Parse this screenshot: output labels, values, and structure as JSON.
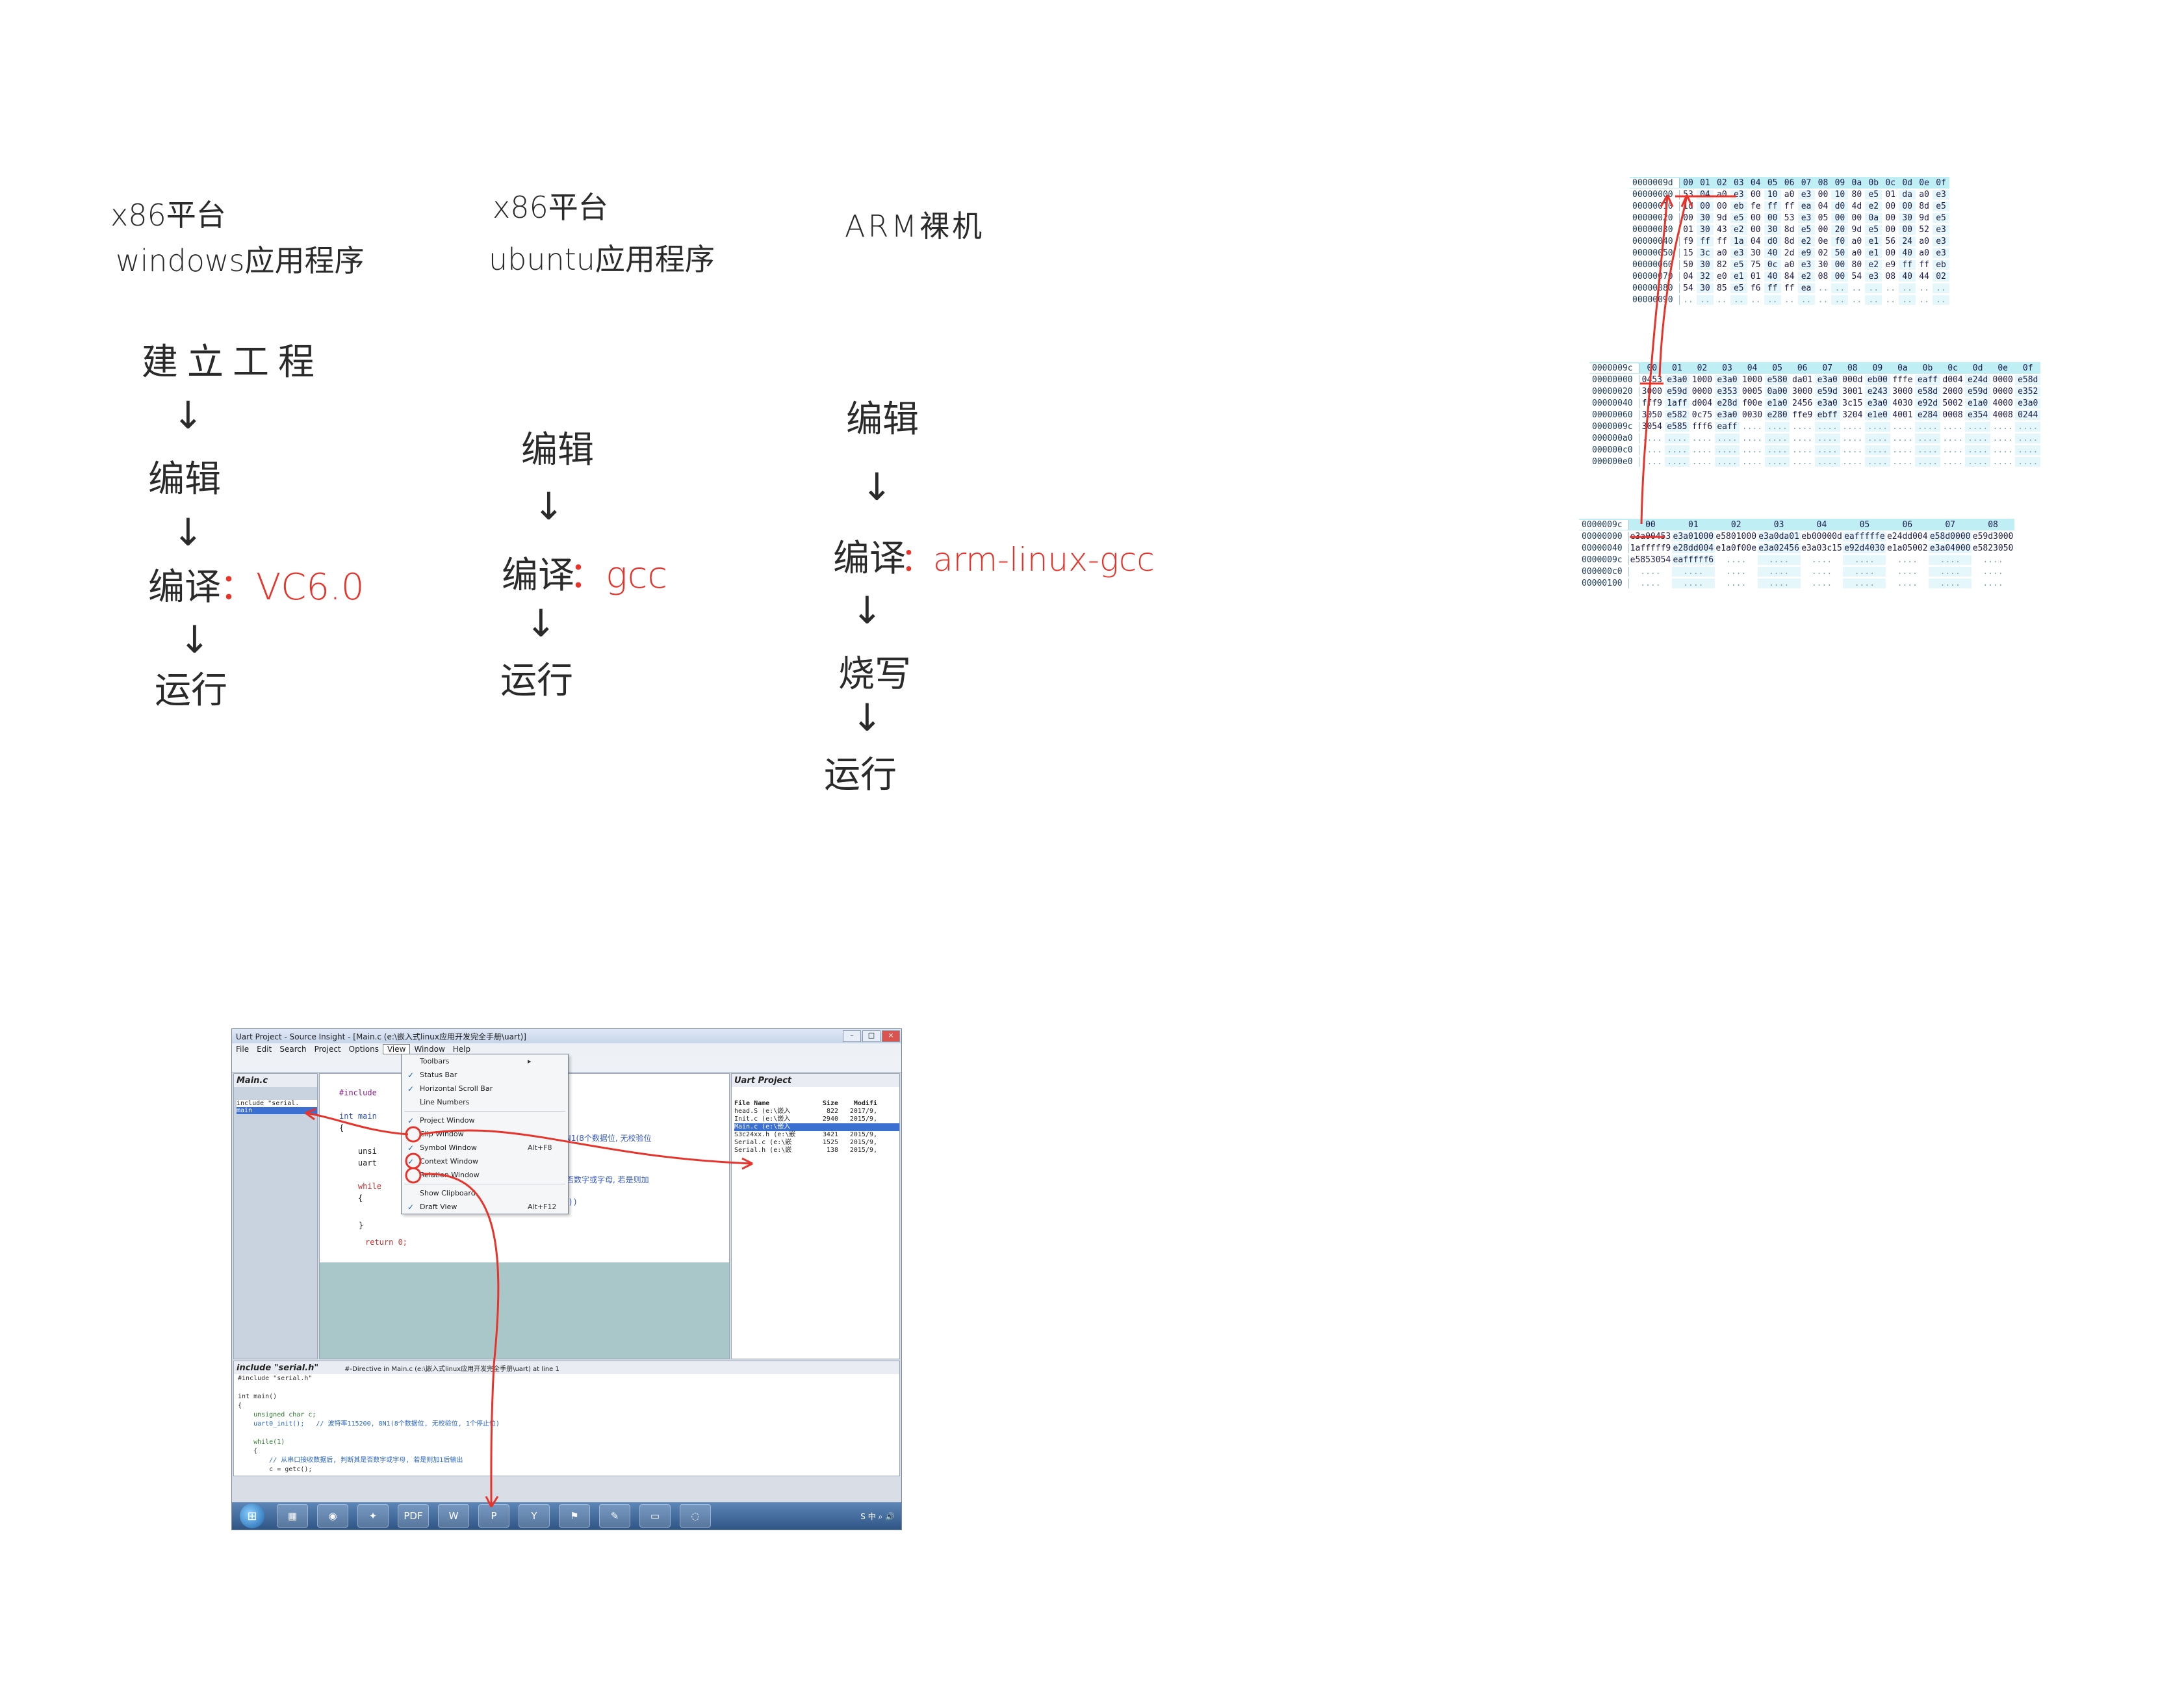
{
  "col1": {
    "platform": "x86平台",
    "app_type": "windows应用程序",
    "steps": [
      "建立工程",
      "编辑",
      "编译",
      "运行"
    ],
    "compiler": "：VC6.0"
  },
  "col2": {
    "platform": "x86平台",
    "app_type": "ubuntu应用程序",
    "steps": [
      "编辑",
      "编译",
      "运行"
    ],
    "compiler": "：gcc"
  },
  "col3": {
    "platform": "ARM裸机",
    "steps": [
      "编辑",
      "编译",
      "烧写",
      "运行"
    ],
    "compiler": "：arm-linux-gcc"
  },
  "arrow_glyph": "↓",
  "hex1": {
    "corner": "0000009d",
    "header": [
      "00",
      "01",
      "02",
      "03",
      "04",
      "05",
      "06",
      "07",
      "08",
      "09",
      "0a",
      "0b",
      "0c",
      "0d",
      "0e",
      "0f"
    ],
    "rows": [
      {
        "addr": "00000000",
        "bytes": [
          "53",
          "04",
          "a0",
          "e3",
          "00",
          "10",
          "a0",
          "e3",
          "00",
          "10",
          "80",
          "e5",
          "01",
          "da",
          "a0",
          "e3"
        ]
      },
      {
        "addr": "00000010",
        "bytes": [
          "1d",
          "00",
          "00",
          "eb",
          "fe",
          "ff",
          "ff",
          "ea",
          "04",
          "d0",
          "4d",
          "e2",
          "00",
          "00",
          "8d",
          "e5"
        ]
      },
      {
        "addr": "00000020",
        "bytes": [
          "00",
          "30",
          "9d",
          "e5",
          "00",
          "00",
          "53",
          "e3",
          "05",
          "00",
          "00",
          "0a",
          "00",
          "30",
          "9d",
          "e5"
        ]
      },
      {
        "addr": "00000030",
        "bytes": [
          "01",
          "30",
          "43",
          "e2",
          "00",
          "30",
          "8d",
          "e5",
          "00",
          "20",
          "9d",
          "e5",
          "00",
          "00",
          "52",
          "e3"
        ]
      },
      {
        "addr": "00000040",
        "bytes": [
          "f9",
          "ff",
          "ff",
          "1a",
          "04",
          "d0",
          "8d",
          "e2",
          "0e",
          "f0",
          "a0",
          "e1",
          "56",
          "24",
          "a0",
          "e3"
        ]
      },
      {
        "addr": "00000050",
        "bytes": [
          "15",
          "3c",
          "a0",
          "e3",
          "30",
          "40",
          "2d",
          "e9",
          "02",
          "50",
          "a0",
          "e1",
          "00",
          "40",
          "a0",
          "e3"
        ]
      },
      {
        "addr": "00000060",
        "bytes": [
          "50",
          "30",
          "82",
          "e5",
          "75",
          "0c",
          "a0",
          "e3",
          "30",
          "00",
          "80",
          "e2",
          "e9",
          "ff",
          "ff",
          "eb"
        ]
      },
      {
        "addr": "00000070",
        "bytes": [
          "04",
          "32",
          "e0",
          "e1",
          "01",
          "40",
          "84",
          "e2",
          "08",
          "00",
          "54",
          "e3",
          "08",
          "40",
          "44",
          "02"
        ]
      },
      {
        "addr": "00000080",
        "bytes": [
          "54",
          "30",
          "85",
          "e5",
          "f6",
          "ff",
          "ff",
          "ea",
          "",
          "",
          "",
          "",
          "",
          "",
          "",
          ""
        ]
      },
      {
        "addr": "00000090",
        "bytes": [
          "",
          "",
          "",
          "",
          "",
          "",
          "",
          "",
          "",
          "",
          "",
          "",
          "",
          "",
          "",
          ""
        ]
      }
    ]
  },
  "hex2": {
    "corner": "0000009c",
    "header": [
      "00",
      "01",
      "02",
      "03",
      "04",
      "05",
      "06",
      "07",
      "08",
      "09",
      "0a",
      "0b",
      "0c",
      "0d",
      "0e",
      "0f"
    ],
    "rows": [
      {
        "addr": "00000000",
        "words": [
          "0453",
          "e3a0",
          "1000",
          "e3a0",
          "1000",
          "e580",
          "da01",
          "e3a0",
          "000d",
          "eb00",
          "fffe",
          "eaff",
          "d004",
          "e24d",
          "0000",
          "e58d"
        ]
      },
      {
        "addr": "00000020",
        "words": [
          "3000",
          "e59d",
          "0000",
          "e353",
          "0005",
          "0a00",
          "3000",
          "e59d",
          "3001",
          "e243",
          "3000",
          "e58d",
          "2000",
          "e59d",
          "0000",
          "e352"
        ]
      },
      {
        "addr": "00000040",
        "words": [
          "fff9",
          "1aff",
          "d004",
          "e28d",
          "f00e",
          "e1a0",
          "2456",
          "e3a0",
          "3c15",
          "e3a0",
          "4030",
          "e92d",
          "5002",
          "e1a0",
          "4000",
          "e3a0"
        ]
      },
      {
        "addr": "00000060",
        "words": [
          "3050",
          "e582",
          "0c75",
          "e3a0",
          "0030",
          "e280",
          "ffe9",
          "ebff",
          "3204",
          "e1e0",
          "4001",
          "e284",
          "0008",
          "e354",
          "4008",
          "0244"
        ]
      },
      {
        "addr": "0000009c",
        "words": [
          "3054",
          "e585",
          "fff6",
          "eaff",
          "",
          "",
          "",
          "",
          "",
          "",
          "",
          "",
          "",
          "",
          "",
          ""
        ]
      },
      {
        "addr": "000000a0",
        "words": [
          "",
          "",
          "",
          "",
          "",
          "",
          "",
          "",
          "",
          "",
          "",
          "",
          "",
          "",
          "",
          ""
        ]
      },
      {
        "addr": "000000c0",
        "words": [
          "",
          "",
          "",
          "",
          "",
          "",
          "",
          "",
          "",
          "",
          "",
          "",
          "",
          "",
          "",
          ""
        ]
      },
      {
        "addr": "000000e0",
        "words": [
          "",
          "",
          "",
          "",
          "",
          "",
          "",
          "",
          "",
          "",
          "",
          "",
          "",
          "",
          "",
          ""
        ]
      }
    ]
  },
  "hex3": {
    "corner": "0000009c",
    "header": [
      "00",
      "01",
      "02",
      "03",
      "04",
      "05",
      "06",
      "07",
      "08"
    ],
    "rows": [
      {
        "addr": "00000000",
        "dwords": [
          "e3a00453",
          "e3a01000",
          "e5801000",
          "e3a0da01",
          "eb00000d",
          "eafffffe",
          "e24dd004",
          "e58d0000",
          "e59d3000"
        ]
      },
      {
        "addr": "00000040",
        "dwords": [
          "1afffff9",
          "e28dd004",
          "e1a0f00e",
          "e3a02456",
          "e3a03c15",
          "e92d4030",
          "e1a05002",
          "e3a04000",
          "e5823050"
        ]
      },
      {
        "addr": "0000009c",
        "dwords": [
          "e5853054",
          "eafffff6",
          "",
          "",
          "",
          "",
          "",
          "",
          ""
        ]
      },
      {
        "addr": "000000c0",
        "dwords": [
          "",
          "",
          "",
          "",
          "",
          "",
          "",
          "",
          ""
        ]
      },
      {
        "addr": "00000100",
        "dwords": [
          "",
          "",
          "",
          "",
          "",
          "",
          "",
          "",
          ""
        ]
      }
    ]
  },
  "screenshot": {
    "title": "Uart Project - Source Insight - [Main.c (e:\\嵌入式linux应用开发完全手册\\uart)]",
    "window_controls": [
      "–",
      "□",
      "×"
    ],
    "menu": [
      "File",
      "Edit",
      "Search",
      "Project",
      "Options",
      "View",
      "Window",
      "Help"
    ],
    "symbol_pane": {
      "title": "Main.c",
      "items": [
        "include \"serial.",
        "main"
      ]
    },
    "editor_lines": [
      "#include",
      "",
      "int main",
      "{",
      "    unsi",
      "    uart",
      "",
      "    while",
      "    {",
      "",
      "",
      "",
      ""
    ],
    "editor_fragments": {
      "a": "0, 8N1(8个数据位, 无校验位",
      "b": "其是否数字或字母, 若是则加",
      "c": "(c))",
      "ret": "return 0;",
      "brace_close": "}"
    },
    "view_menu": [
      {
        "label": "Toolbars",
        "check": "",
        "shortcut": "",
        "submenu": "▸"
      },
      {
        "label": "Status Bar",
        "check": "✓",
        "shortcut": "",
        "submenu": ""
      },
      {
        "label": "Horizontal Scroll Bar",
        "check": "✓",
        "shortcut": "",
        "submenu": ""
      },
      {
        "label": "Line Numbers",
        "check": "",
        "shortcut": "",
        "submenu": ""
      },
      {
        "label": "Project Window",
        "check": "✓",
        "shortcut": "",
        "submenu": ""
      },
      {
        "label": "Clip Window",
        "check": "",
        "shortcut": "",
        "submenu": ""
      },
      {
        "label": "Symbol Window",
        "check": "✓",
        "shortcut": "Alt+F8",
        "submenu": ""
      },
      {
        "label": "Context Window",
        "check": "✓",
        "shortcut": "",
        "submenu": ""
      },
      {
        "label": "Relation Window",
        "check": "",
        "shortcut": "",
        "submenu": ""
      },
      {
        "label": "Show Clipboard",
        "check": "",
        "shortcut": "",
        "submenu": ""
      },
      {
        "label": "Draft View",
        "check": "✓",
        "shortcut": "Alt+F12",
        "submenu": ""
      }
    ],
    "project_pane": {
      "title": "Uart Project",
      "headers": [
        "File Name",
        "Size",
        "Modifi"
      ],
      "files": [
        {
          "name": "head.S (e:\\嵌入",
          "size": "822",
          "date": "2017/9,"
        },
        {
          "name": "Init.c (e:\\嵌入",
          "size": "2940",
          "date": "2015/9,"
        },
        {
          "name": "Main.c (e:\\嵌入",
          "size": "",
          "date": "",
          "selected": true
        },
        {
          "name": "S3c24xx.h (e:\\嵌",
          "size": "3421",
          "date": "2015/9,"
        },
        {
          "name": "Serial.c (e:\\嵌",
          "size": "1525",
          "date": "2015/9,"
        },
        {
          "name": "Serial.h (e:\\嵌",
          "size": "138",
          "date": "2015/9,"
        }
      ]
    },
    "context_pane": {
      "title": "include \"serial.h\"",
      "subtitle": "#-Directive in Main.c (e:\\嵌入式linux应用开发完全手册\\uart) at line 1",
      "lines": [
        "#include \"serial.h\"",
        "",
        "int main()",
        "{",
        "    unsigned char c;",
        "    uart0_init();   // 波特率115200, 8N1(8个数据位, 无校验位, 1个停止位)",
        "",
        "    while(1)",
        "    {",
        "        // 从串口接收数据后, 判断其是否数字或字母, 若是则加1后输出",
        "        c = getc();"
      ]
    },
    "taskbar": {
      "items": [
        "▦",
        "◉",
        "✦",
        "PDF",
        "W",
        "P",
        "Y",
        "⚑",
        "✎",
        "▭",
        "◌"
      ],
      "tray": "S 中 ⌕ 🔊"
    }
  },
  "colors": {
    "accent_red": "#e8332a",
    "hex_header": "#bfeef5",
    "hex_sel": "#7fcf99"
  }
}
